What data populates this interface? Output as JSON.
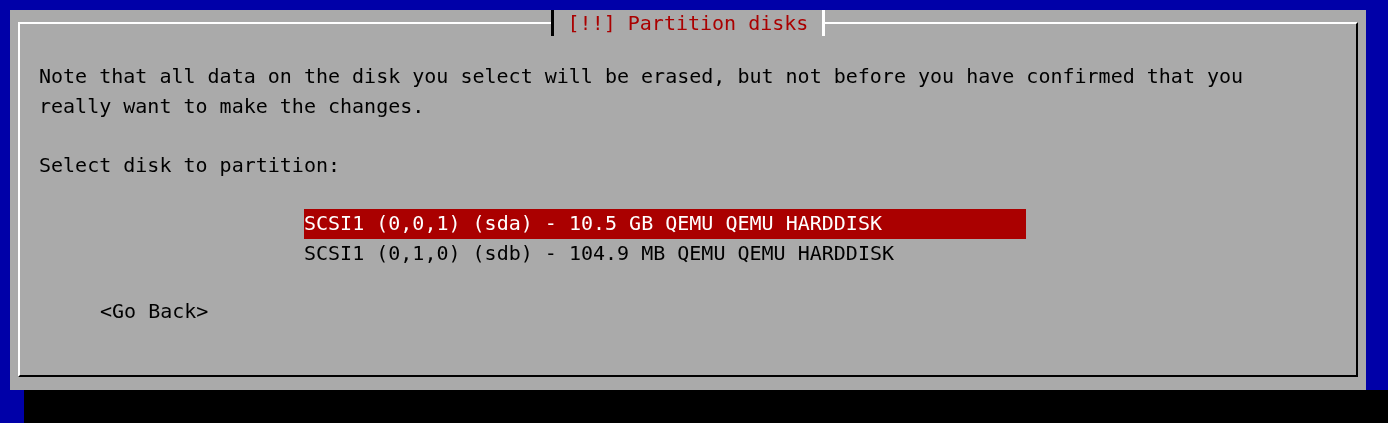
{
  "dialog": {
    "title": "[!!] Partition disks",
    "message": "Note that all data on the disk you select will be erased, but not before you have confirmed that you really want to make the changes.",
    "prompt": "Select disk to partition:",
    "disks": [
      {
        "label": "SCSI1 (0,0,1) (sda) - 10.5 GB QEMU QEMU HARDDISK",
        "selected": true
      },
      {
        "label": "SCSI1 (0,1,0) (sdb) - 104.9 MB QEMU QEMU HARDDISK",
        "selected": false
      }
    ],
    "buttons": [
      {
        "label": "<Go Back>"
      }
    ]
  }
}
